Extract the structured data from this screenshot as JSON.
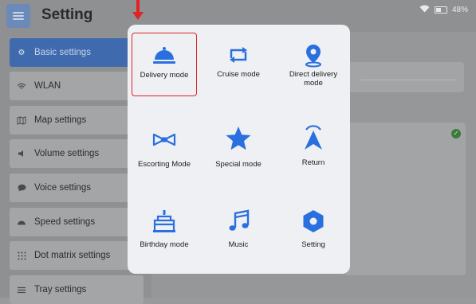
{
  "header": {
    "title": "Setting",
    "battery": "48%"
  },
  "sidebar": {
    "items": [
      {
        "label": "Basic settings",
        "icon": "gear-icon",
        "active": true
      },
      {
        "label": "WLAN",
        "icon": "wifi-icon"
      },
      {
        "label": "Map settings",
        "icon": "map-icon"
      },
      {
        "label": "Volume settings",
        "icon": "volume-icon"
      },
      {
        "label": "Voice settings",
        "icon": "chat-icon"
      },
      {
        "label": "Speed settings",
        "icon": "speedometer-icon"
      },
      {
        "label": "Dot matrix settings",
        "icon": "dot-matrix-icon"
      },
      {
        "label": "Tray settings",
        "icon": "tray-icon"
      }
    ]
  },
  "mode_menu": {
    "items": [
      {
        "label": "Delivery mode",
        "icon": "cloche-icon",
        "selected": true
      },
      {
        "label": "Cruise mode",
        "icon": "loop-arrows-icon"
      },
      {
        "label": "Direct delivery mode",
        "icon": "location-pin-icon"
      },
      {
        "label": "Escorting Mode",
        "icon": "bow-tie-icon"
      },
      {
        "label": "Special mode",
        "icon": "star-icon"
      },
      {
        "label": "Return",
        "icon": "return-arrow-icon"
      },
      {
        "label": "Birthday mode",
        "icon": "cake-icon"
      },
      {
        "label": "Music",
        "icon": "music-note-icon"
      },
      {
        "label": "Setting",
        "icon": "hex-nut-icon"
      }
    ],
    "accent": "#2a6fe0",
    "selection_color": "#e02323"
  }
}
